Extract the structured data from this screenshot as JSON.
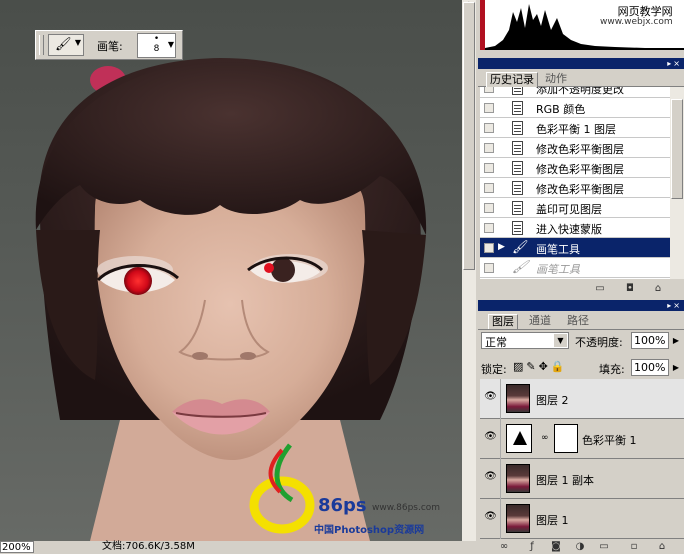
{
  "tool_options": {
    "brush_label": "画笔:",
    "brush_size": "8",
    "brush_dot": "•"
  },
  "status": {
    "zoom": "200%",
    "doc_size": "文档:706.6K/3.58M"
  },
  "watermark": {
    "line1": "网页教学网",
    "line2": "www.webjx.com",
    "logo_text": "86ps",
    "logo_url": "www.86ps.com",
    "logo_caption": "中国Photoshop资源网"
  },
  "history_panel": {
    "tabs": [
      {
        "label": "历史记录",
        "active": true
      },
      {
        "label": "动作",
        "active": false
      }
    ],
    "items": [
      {
        "label": "添加不透明度更改",
        "state": "normal"
      },
      {
        "label": "RGB 颜色",
        "state": "normal"
      },
      {
        "label": "色彩平衡 1 图层",
        "state": "normal"
      },
      {
        "label": "修改色彩平衡图层",
        "state": "normal"
      },
      {
        "label": "修改色彩平衡图层",
        "state": "normal"
      },
      {
        "label": "修改色彩平衡图层",
        "state": "normal"
      },
      {
        "label": "盖印可见图层",
        "state": "normal"
      },
      {
        "label": "进入快速蒙版",
        "state": "normal"
      },
      {
        "label": "画笔工具",
        "state": "selected"
      },
      {
        "label": "画笔工具",
        "state": "dimmed"
      }
    ]
  },
  "layers_panel": {
    "tabs": [
      {
        "label": "图层",
        "active": true
      },
      {
        "label": "通道",
        "active": false
      },
      {
        "label": "路径",
        "active": false
      }
    ],
    "blend_mode": "正常",
    "opacity_label": "不透明度:",
    "opacity_value": "100%",
    "lock_label": "锁定:",
    "fill_label": "填充:",
    "fill_value": "100%",
    "layers": [
      {
        "name": "图层 2",
        "type": "image",
        "selected": true
      },
      {
        "name": "色彩平衡 1",
        "type": "adjustment",
        "selected": false
      },
      {
        "name": "图层 1 副本",
        "type": "image",
        "selected": false
      },
      {
        "name": "图层 1",
        "type": "image",
        "selected": false
      }
    ]
  },
  "colors": {
    "selection_blue": "#0a246a",
    "panel_gray": "#d4d0c8",
    "red_eye": "#e0101a"
  }
}
